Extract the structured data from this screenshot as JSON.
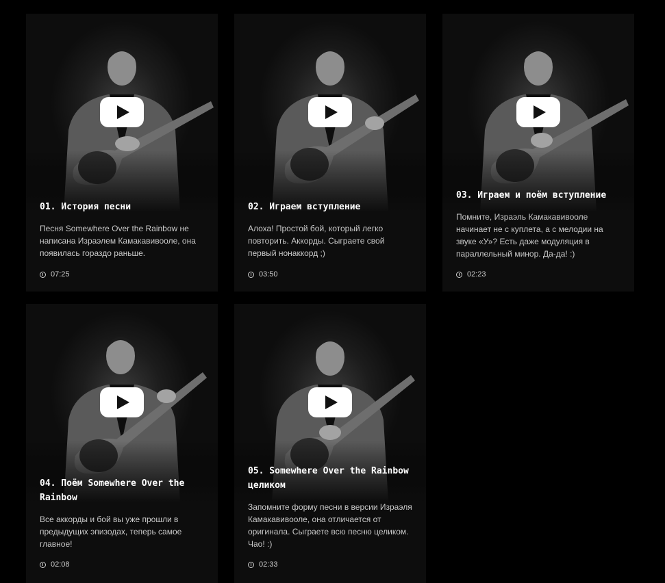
{
  "colors": {
    "background": "#000000",
    "card": "#0d0d0d",
    "title": "#ffffff",
    "text": "#c9c9c9",
    "play_button": "#ffffff"
  },
  "lessons": [
    {
      "title": "01. История песни",
      "description": "Песня Somewhere Over the Rainbow не написана Израэлем Камакавивооле, она появилась гораздо раньше.",
      "duration": "07:25",
      "play_icon": "youtube-play-icon",
      "duration_icon": "clock-icon"
    },
    {
      "title": "02. Играем вступление",
      "description": "Алоха! Простой бой, который легко повторить. Аккорды. Сыграете свой первый нонаккорд ;)",
      "duration": "03:50",
      "play_icon": "youtube-play-icon",
      "duration_icon": "clock-icon"
    },
    {
      "title": "03. Играем и поём вступление",
      "description": "Помните, Израэль Камакавивооле начинает не с куплета, а с мелодии на звуке «У»? Есть даже модуляция в параллельный минор. Да-да! :)",
      "duration": "02:23",
      "play_icon": "youtube-play-icon",
      "duration_icon": "clock-icon"
    },
    {
      "title": "04. Поём Somewhere Over the Rainbow",
      "description": "Все аккорды и бой вы уже прошли в предыдущих эпизодах, теперь самое главное!",
      "duration": "02:08",
      "play_icon": "youtube-play-icon",
      "duration_icon": "clock-icon"
    },
    {
      "title": "05. Somewhere Over the Rainbow целиком",
      "description": "Запомните форму песни в версии Израэля Камакавивооле, она отличается от оригинала. Сыграете всю песню целиком. Чао! :)",
      "duration": "02:33",
      "play_icon": "youtube-play-icon",
      "duration_icon": "clock-icon"
    }
  ]
}
